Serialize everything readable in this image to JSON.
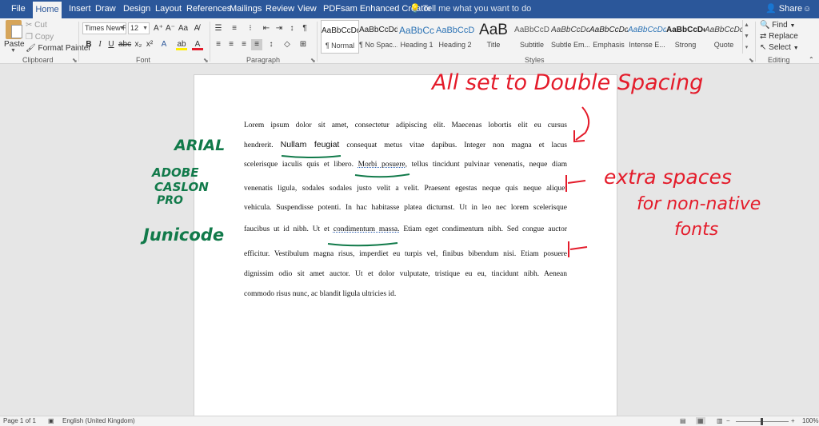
{
  "tabs": {
    "file": "File",
    "home": "Home",
    "insert": "Insert",
    "draw": "Draw",
    "design": "Design",
    "layout": "Layout",
    "references": "References",
    "mailings": "Mailings",
    "review": "Review",
    "view": "View",
    "pdfsam": "PDFsam Enhanced Creator",
    "tell_me": "Tell me what you want to do",
    "share": "Share"
  },
  "clipboard": {
    "paste": "Paste",
    "cut": "Cut",
    "copy": "Copy",
    "format_painter": "Format Painter",
    "group_label": "Clipboard"
  },
  "font": {
    "family": "Times New Ro",
    "size": "12",
    "group_label": "Font"
  },
  "paragraph": {
    "group_label": "Paragraph"
  },
  "styles": {
    "group_label": "Styles",
    "items": [
      {
        "sample": "AaBbCcDd",
        "name": "¶ Normal"
      },
      {
        "sample": "AaBbCcDd",
        "name": "¶ No Spac..."
      },
      {
        "sample": "AaBbCc",
        "name": "Heading 1"
      },
      {
        "sample": "AaBbCcD",
        "name": "Heading 2"
      },
      {
        "sample": "AaB",
        "name": "Title"
      },
      {
        "sample": "AaBbCcD",
        "name": "Subtitle"
      },
      {
        "sample": "AaBbCcDd",
        "name": "Subtle Em..."
      },
      {
        "sample": "AaBbCcDd",
        "name": "Emphasis"
      },
      {
        "sample": "AaBbCcDd",
        "name": "Intense E..."
      },
      {
        "sample": "AaBbCcDc",
        "name": "Strong"
      },
      {
        "sample": "AaBbCcDd",
        "name": "Quote"
      }
    ]
  },
  "editing": {
    "find": "Find",
    "replace": "Replace",
    "select": "Select",
    "group_label": "Editing"
  },
  "document": {
    "lines": [
      "Lorem ipsum dolor sit amet, consectetur adipiscing elit. Maecenas lobortis elit eu cursus",
      [
        "hendrerit. ",
        "Nullam feugiat",
        " consequat metus vitae dapibus. Integer non magna et lacus"
      ],
      [
        "scelerisque iaculis quis et libero. ",
        "Morbi posuere,",
        " tellus tincidunt pulvinar venenatis, neque diam"
      ],
      "venenatis ligula, sodales sodales justo velit a velit. Praesent egestas neque quis neque aliquet",
      "vehicula. Suspendisse potenti. In hac habitasse platea dictumst. Ut in leo nec lorem scelerisque",
      [
        "faucibus ut id nibh. Ut et ",
        "condimentum massa.",
        " Etiam eget condimentum nibh. Sed congue auctor"
      ],
      "efficitur. Vestibulum magna risus, imperdiet eu turpis vel, finibus bibendum nisi. Etiam posuere",
      "dignissim odio sit amet auctor. Ut et dolor vulputate, tristique eu eu, tincidunt nibh. Aenean",
      "commodo risus nunc, ac blandit ligula ultricies id."
    ]
  },
  "annotations": {
    "title": "All set to Double Spacing",
    "extra_spaces": "extra spaces",
    "for_non_native": "for non-native",
    "fonts": "fonts",
    "arial": "ARIAL",
    "adobe": "ADOBE",
    "caslon": "CASLON",
    "pro": "PRO",
    "junicode": "Junicode"
  },
  "statusbar": {
    "page": "Page 1 of 1",
    "language": "English (United Kingdom)",
    "zoom": "100%"
  },
  "colors": {
    "accent": "#2b579a",
    "annotation_red": "#e41b2a",
    "annotation_green": "#117a4a"
  }
}
